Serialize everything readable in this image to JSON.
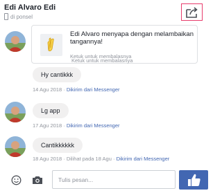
{
  "header": {
    "title": "Edi Alvaro Edi",
    "subtitle": "di ponsel",
    "share_icon": "share-icon",
    "accent": "#e83b6b"
  },
  "wave_card": {
    "title": "Edi Alvaro menyapa dengan melambaikan tangannya!",
    "subtitle": "Ketuk untuk membalasnya",
    "reply_label": "Ketuk untuk membalasnya",
    "icon": "waving-hand-icon"
  },
  "messages": [
    {
      "text": "Hy cantikkk",
      "date": "14 Agu 2018",
      "sep": "·",
      "source": "Dikirim dari Messenger"
    },
    {
      "text": "Lg app",
      "date": "17 Agu 2018",
      "sep": "·",
      "source": "Dikirim dari Messenger"
    },
    {
      "text": "Cantikkkkkk",
      "date": "18 Agu 2018",
      "sep": "·",
      "seen": "Dilihat pada 18 Agu",
      "sep2": "·",
      "source": "Dikirim dari Messenger"
    }
  ],
  "composer": {
    "placeholder": "Tulis pesan...",
    "emoji_icon": "smiley-icon",
    "camera_icon": "camera-icon",
    "like_icon": "thumbs-up-icon",
    "like_color": "#4267b2"
  }
}
